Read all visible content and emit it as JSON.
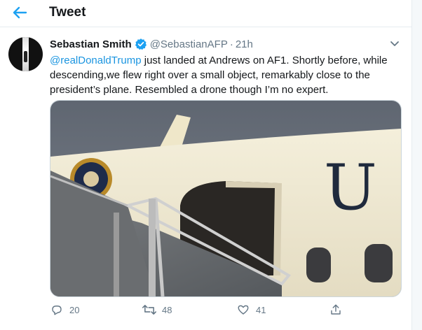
{
  "header": {
    "title": "Tweet"
  },
  "tweet": {
    "author_name": "Sebastian Smith",
    "handle": "@SebastianAFP",
    "separator": "·",
    "timestamp": "21h",
    "mention": "@realDonaldTrump",
    "text": " just landed at Andrews on AF1. Shortly before, while descending,we flew right over a small object, remarkably close to the president’s plane. Resembled a drone though I’m no expert.",
    "image_tail_lettering": "U",
    "counts": {
      "replies": "20",
      "retweets": "48",
      "likes": "41"
    }
  },
  "icons": {
    "back": "arrow-left-icon",
    "verified": "verified-badge-icon",
    "caret": "chevron-down-icon",
    "reply": "reply-icon",
    "retweet": "retweet-icon",
    "like": "heart-icon",
    "share": "share-icon"
  },
  "colors": {
    "accent": "#1da1f2",
    "link": "#1b95e0",
    "muted": "#657786",
    "text": "#14171a",
    "border": "#e6ecf0"
  }
}
